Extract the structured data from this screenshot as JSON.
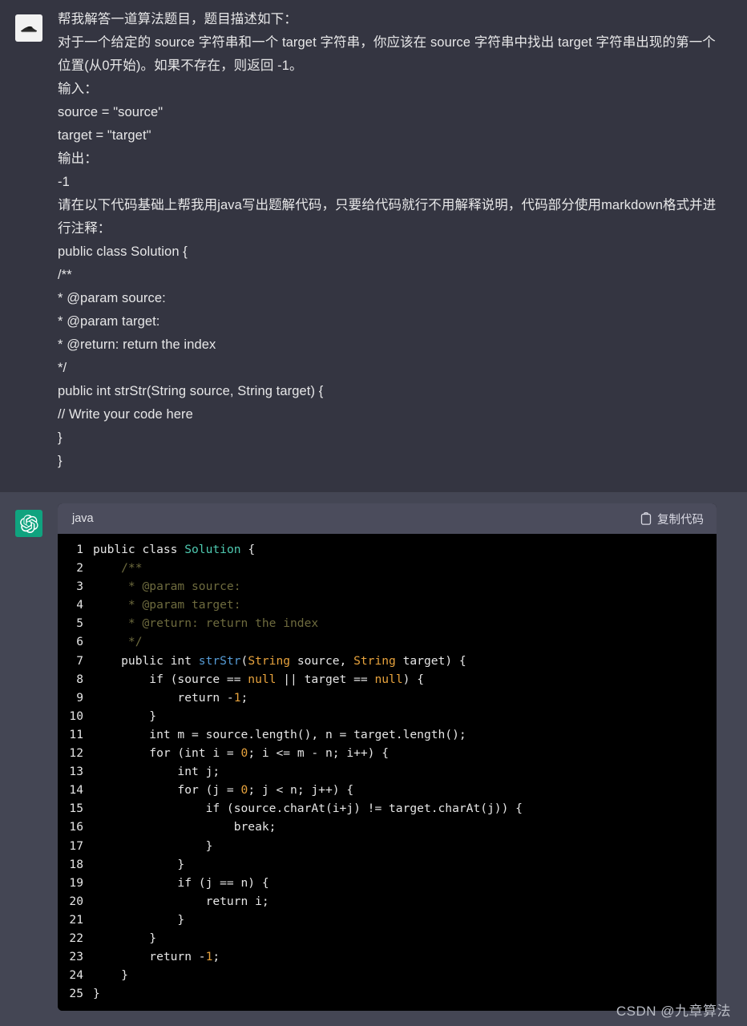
{
  "user_message": {
    "avatar_icon": "user-avatar-image",
    "lines": [
      "帮我解答一道算法题目，题目描述如下：",
      "对于一个给定的 source 字符串和一个 target 字符串，你应该在 source 字符串中找出 target 字符串出现的第一个位置(从0开始)。如果不存在，则返回 -1。",
      "输入：",
      "source = \"source\"",
      "target = \"target\"",
      "输出：",
      "-1",
      "请在以下代码基础上帮我用java写出题解代码，只要给代码就行不用解释说明，代码部分使用markdown格式并进行注释：",
      "public class Solution {",
      "/**",
      "* @param source:",
      "* @param target:",
      "* @return: return the index",
      "*/",
      "public int strStr(String source, String target) {",
      "// Write your code here",
      "}",
      "}"
    ]
  },
  "assistant_message": {
    "avatar_icon": "chatgpt-logo-icon",
    "codeblock": {
      "language_label": "java",
      "copy_label": "复制代码",
      "copy_icon": "clipboard-icon",
      "first_line_number": 1,
      "last_line_number": 25,
      "lines": [
        {
          "n": 1,
          "tokens": [
            {
              "t": "public class ",
              "c": "t-kw"
            },
            {
              "t": "Solution",
              "c": "t-cls"
            },
            {
              "t": " {",
              "c": "t-pl"
            }
          ]
        },
        {
          "n": 2,
          "tokens": [
            {
              "t": "    /**",
              "c": "t-com"
            }
          ]
        },
        {
          "n": 3,
          "tokens": [
            {
              "t": "     * @param source:",
              "c": "t-com"
            }
          ]
        },
        {
          "n": 4,
          "tokens": [
            {
              "t": "     * @param target:",
              "c": "t-com"
            }
          ]
        },
        {
          "n": 5,
          "tokens": [
            {
              "t": "     * @return: return the index",
              "c": "t-com"
            }
          ]
        },
        {
          "n": 6,
          "tokens": [
            {
              "t": "     */",
              "c": "t-com"
            }
          ]
        },
        {
          "n": 7,
          "tokens": [
            {
              "t": "    public int ",
              "c": "t-kw"
            },
            {
              "t": "strStr",
              "c": "t-fn"
            },
            {
              "t": "(",
              "c": "t-pl"
            },
            {
              "t": "String",
              "c": "t-type"
            },
            {
              "t": " source, ",
              "c": "t-pl"
            },
            {
              "t": "String",
              "c": "t-type"
            },
            {
              "t": " target) {",
              "c": "t-pl"
            }
          ]
        },
        {
          "n": 8,
          "tokens": [
            {
              "t": "        if (source == ",
              "c": "t-kw"
            },
            {
              "t": "null",
              "c": "t-type"
            },
            {
              "t": " || target == ",
              "c": "t-kw"
            },
            {
              "t": "null",
              "c": "t-type"
            },
            {
              "t": ") {",
              "c": "t-pl"
            }
          ]
        },
        {
          "n": 9,
          "tokens": [
            {
              "t": "            return -",
              "c": "t-kw"
            },
            {
              "t": "1",
              "c": "t-num"
            },
            {
              "t": ";",
              "c": "t-pl"
            }
          ]
        },
        {
          "n": 10,
          "tokens": [
            {
              "t": "        }",
              "c": "t-pl"
            }
          ]
        },
        {
          "n": 11,
          "tokens": [
            {
              "t": "        int m = source.length(), n = target.length();",
              "c": "t-kw"
            }
          ]
        },
        {
          "n": 12,
          "tokens": [
            {
              "t": "        for (int i = ",
              "c": "t-kw"
            },
            {
              "t": "0",
              "c": "t-num"
            },
            {
              "t": "; i <= m - n; i++) {",
              "c": "t-pl"
            }
          ]
        },
        {
          "n": 13,
          "tokens": [
            {
              "t": "            int j;",
              "c": "t-kw"
            }
          ]
        },
        {
          "n": 14,
          "tokens": [
            {
              "t": "            for (j = ",
              "c": "t-kw"
            },
            {
              "t": "0",
              "c": "t-num"
            },
            {
              "t": "; j < n; j++) {",
              "c": "t-pl"
            }
          ]
        },
        {
          "n": 15,
          "tokens": [
            {
              "t": "                if (source.charAt(i+j) != target.charAt(j)) {",
              "c": "t-kw"
            }
          ]
        },
        {
          "n": 16,
          "tokens": [
            {
              "t": "                    break;",
              "c": "t-kw"
            }
          ]
        },
        {
          "n": 17,
          "tokens": [
            {
              "t": "                }",
              "c": "t-pl"
            }
          ]
        },
        {
          "n": 18,
          "tokens": [
            {
              "t": "            }",
              "c": "t-pl"
            }
          ]
        },
        {
          "n": 19,
          "tokens": [
            {
              "t": "            if (j == n) {",
              "c": "t-kw"
            }
          ]
        },
        {
          "n": 20,
          "tokens": [
            {
              "t": "                return i;",
              "c": "t-kw"
            }
          ]
        },
        {
          "n": 21,
          "tokens": [
            {
              "t": "            }",
              "c": "t-pl"
            }
          ]
        },
        {
          "n": 22,
          "tokens": [
            {
              "t": "        }",
              "c": "t-pl"
            }
          ]
        },
        {
          "n": 23,
          "tokens": [
            {
              "t": "        return -",
              "c": "t-kw"
            },
            {
              "t": "1",
              "c": "t-num"
            },
            {
              "t": ";",
              "c": "t-pl"
            }
          ]
        },
        {
          "n": 24,
          "tokens": [
            {
              "t": "    }",
              "c": "t-pl"
            }
          ]
        },
        {
          "n": 25,
          "tokens": [
            {
              "t": "}",
              "c": "t-pl"
            }
          ]
        }
      ]
    }
  },
  "watermark": {
    "text": "CSDN @九章算法"
  },
  "colors": {
    "user_bg": "#343541",
    "assistant_bg": "#444654",
    "code_bg": "#000000",
    "code_header_bg": "#4b4c5c",
    "brand_green": "#10a37f",
    "class_token": "#4ec9b0",
    "function_token": "#569cd6",
    "type_token": "#e8a33d",
    "comment_token": "#6e6b3e"
  }
}
